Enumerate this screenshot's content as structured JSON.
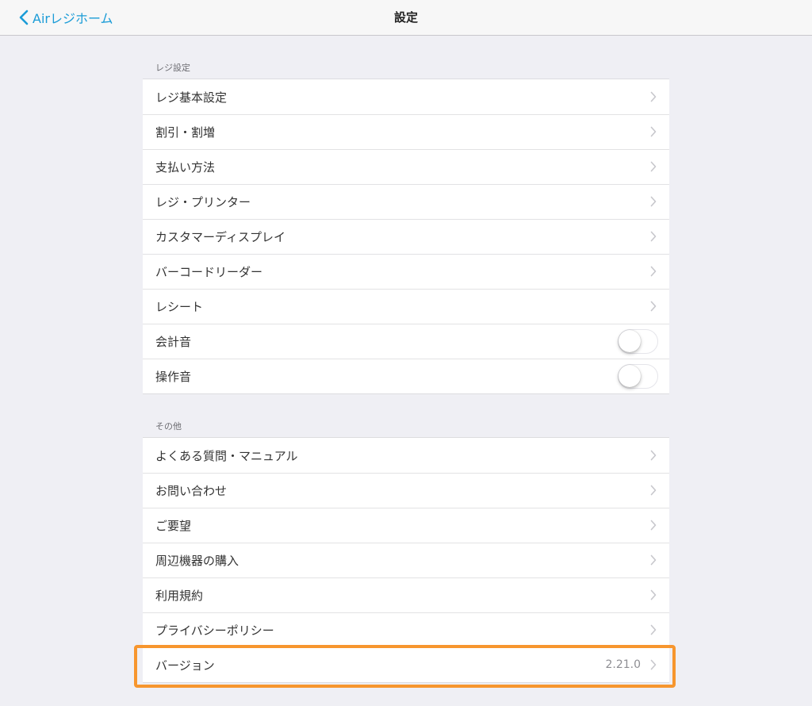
{
  "navbar": {
    "back_label": "Airレジホーム",
    "title": "設定"
  },
  "sections": [
    {
      "header": "レジ設定",
      "items": [
        {
          "label": "レジ基本設定",
          "type": "link"
        },
        {
          "label": "割引・割増",
          "type": "link"
        },
        {
          "label": "支払い方法",
          "type": "link"
        },
        {
          "label": "レジ・プリンター",
          "type": "link"
        },
        {
          "label": "カスタマーディスプレイ",
          "type": "link"
        },
        {
          "label": "バーコードリーダー",
          "type": "link"
        },
        {
          "label": "レシート",
          "type": "link"
        },
        {
          "label": "会計音",
          "type": "toggle",
          "on": false
        },
        {
          "label": "操作音",
          "type": "toggle",
          "on": false
        }
      ]
    },
    {
      "header": "その他",
      "items": [
        {
          "label": "よくある質問・マニュアル",
          "type": "link"
        },
        {
          "label": "お問い合わせ",
          "type": "link"
        },
        {
          "label": "ご要望",
          "type": "link"
        },
        {
          "label": "周辺機器の購入",
          "type": "link"
        },
        {
          "label": "利用規約",
          "type": "link"
        },
        {
          "label": "プライバシーポリシー",
          "type": "link"
        },
        {
          "label": "バージョン",
          "type": "link",
          "value": "2.21.0"
        }
      ]
    }
  ],
  "colors": {
    "accent": "#1b9cd7",
    "highlight": "#f7962e",
    "background": "#efeff4"
  },
  "icons": {
    "back": "chevron-left-icon",
    "row": "chevron-right-icon"
  }
}
